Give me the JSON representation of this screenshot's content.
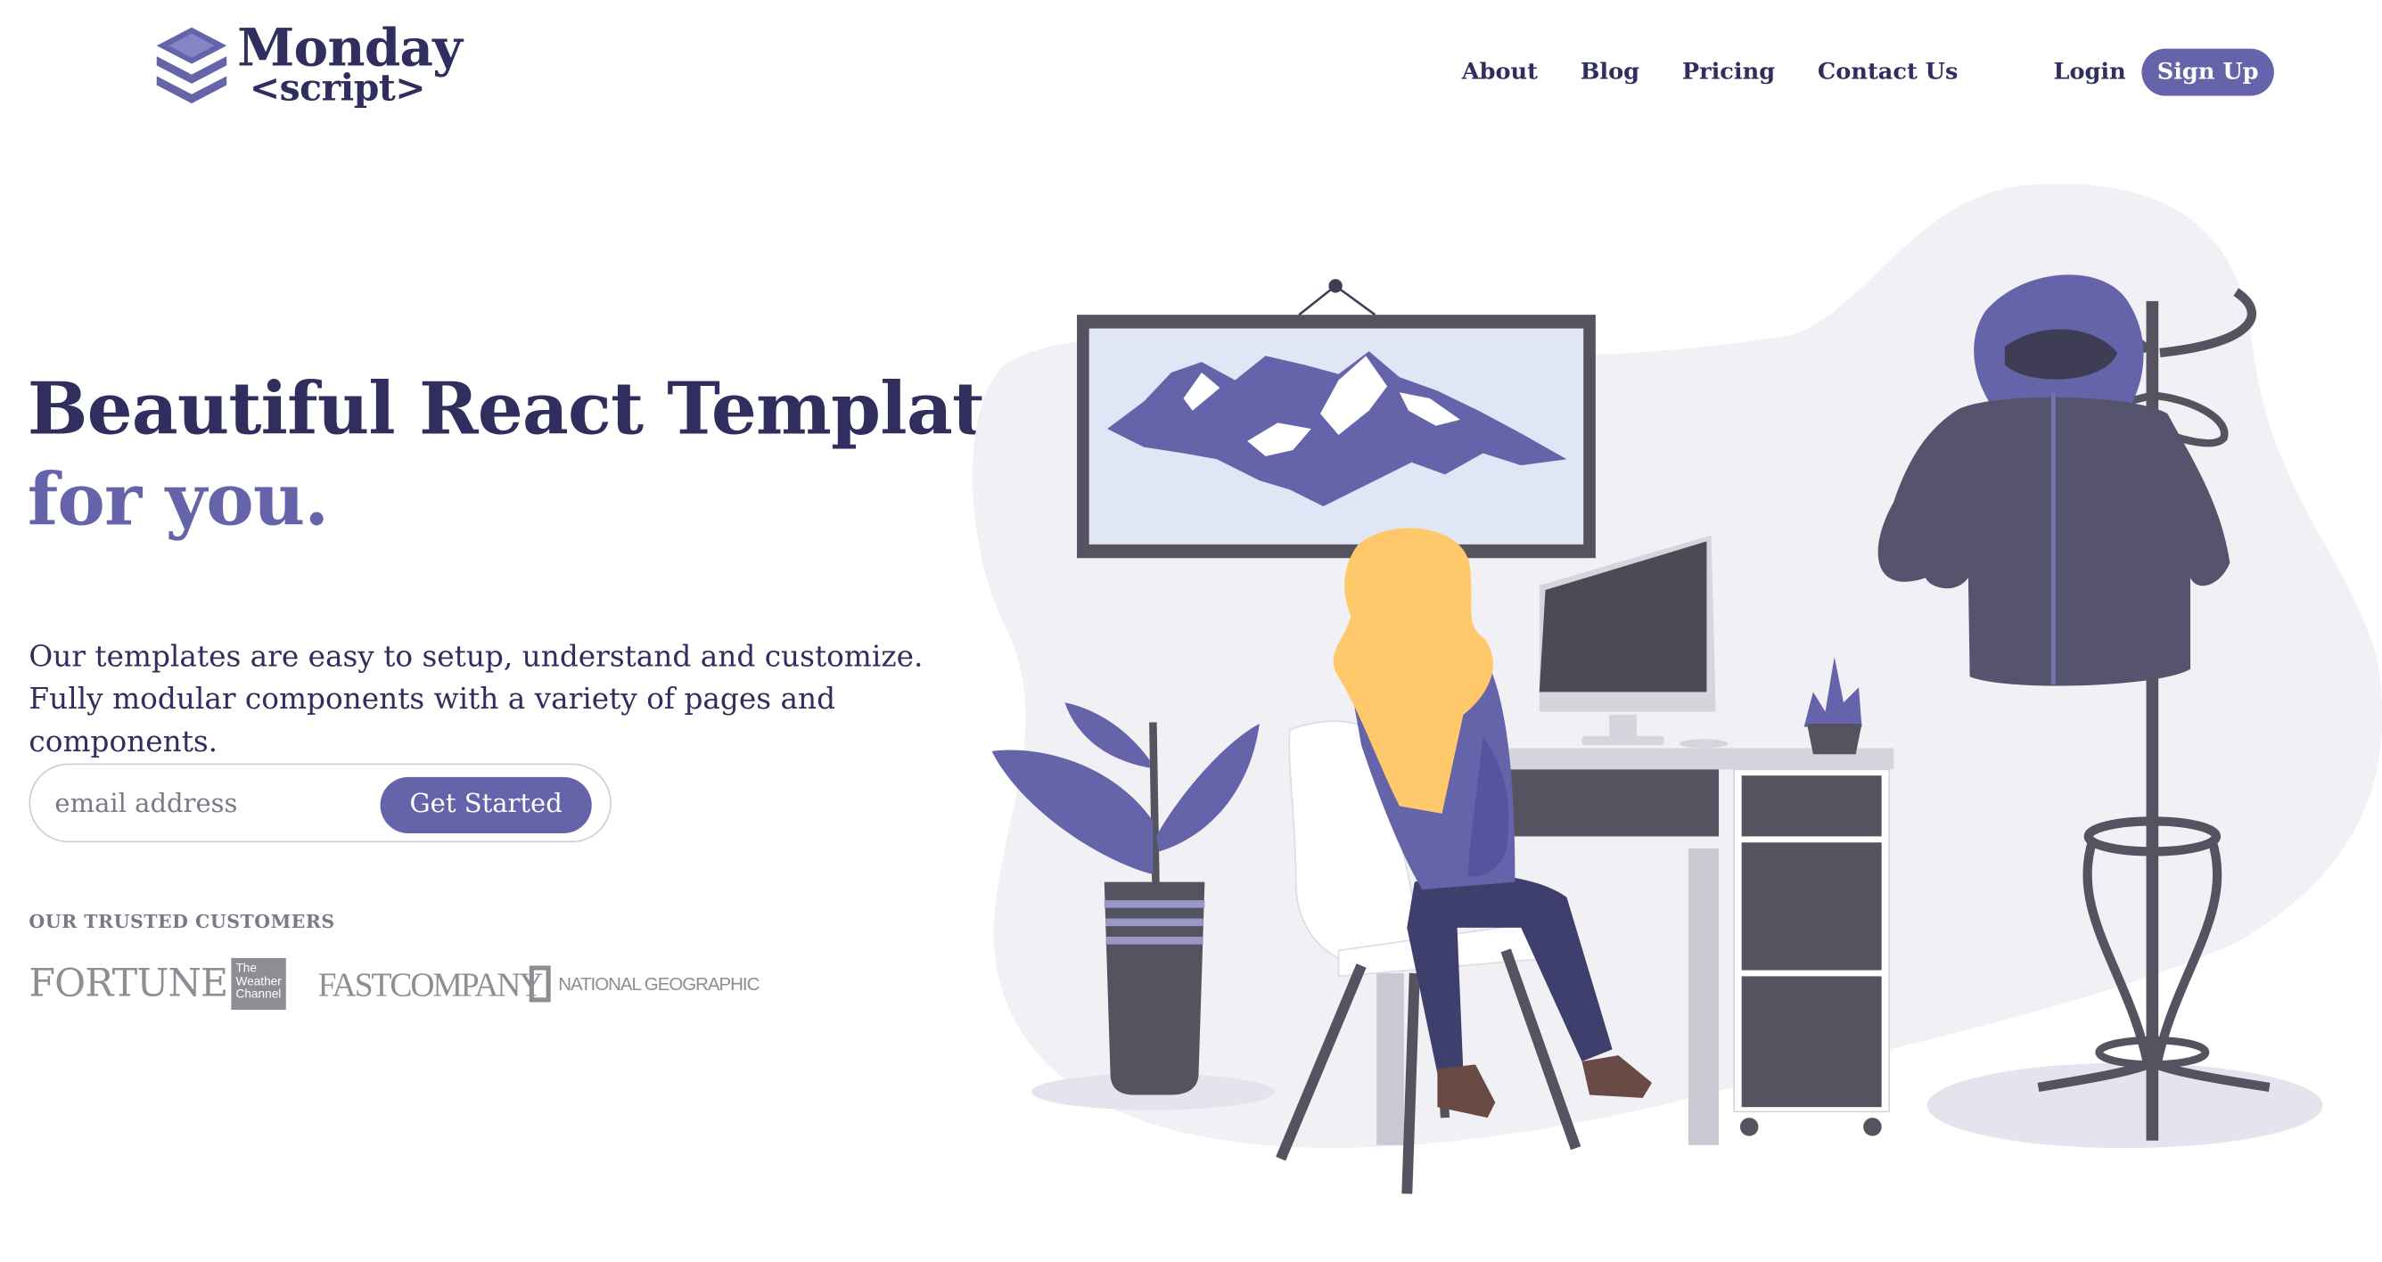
{
  "brand": {
    "name": "Monday",
    "sub": "<script>"
  },
  "nav": {
    "items": [
      {
        "label": "About"
      },
      {
        "label": "Blog"
      },
      {
        "label": "Pricing"
      },
      {
        "label": "Contact Us"
      }
    ],
    "login": "Login",
    "signup": "Sign Up"
  },
  "hero": {
    "title_line1": "Beautiful React Templates",
    "title_line2": "for you.",
    "description": "Our templates are easy to setup, understand and customize. Fully modular components with a variety of pages and components.",
    "email_placeholder": "email address",
    "cta": "Get Started"
  },
  "trusted": {
    "label": "OUR TRUSTED CUSTOMERS",
    "logos": {
      "fortune": "FORTUNE",
      "weather": "The Weather Channel",
      "fastcompany": "FASTCOMPANY",
      "natgeo": "NATIONAL GEOGRAPHIC"
    }
  },
  "colors": {
    "primary": "#6563aa",
    "dark": "#2f2e5f",
    "muted": "#8d8d93",
    "blob": "#f0f0f5",
    "hair": "#ffc86b"
  },
  "icons": {
    "logo": "stacked-layers-icon"
  }
}
